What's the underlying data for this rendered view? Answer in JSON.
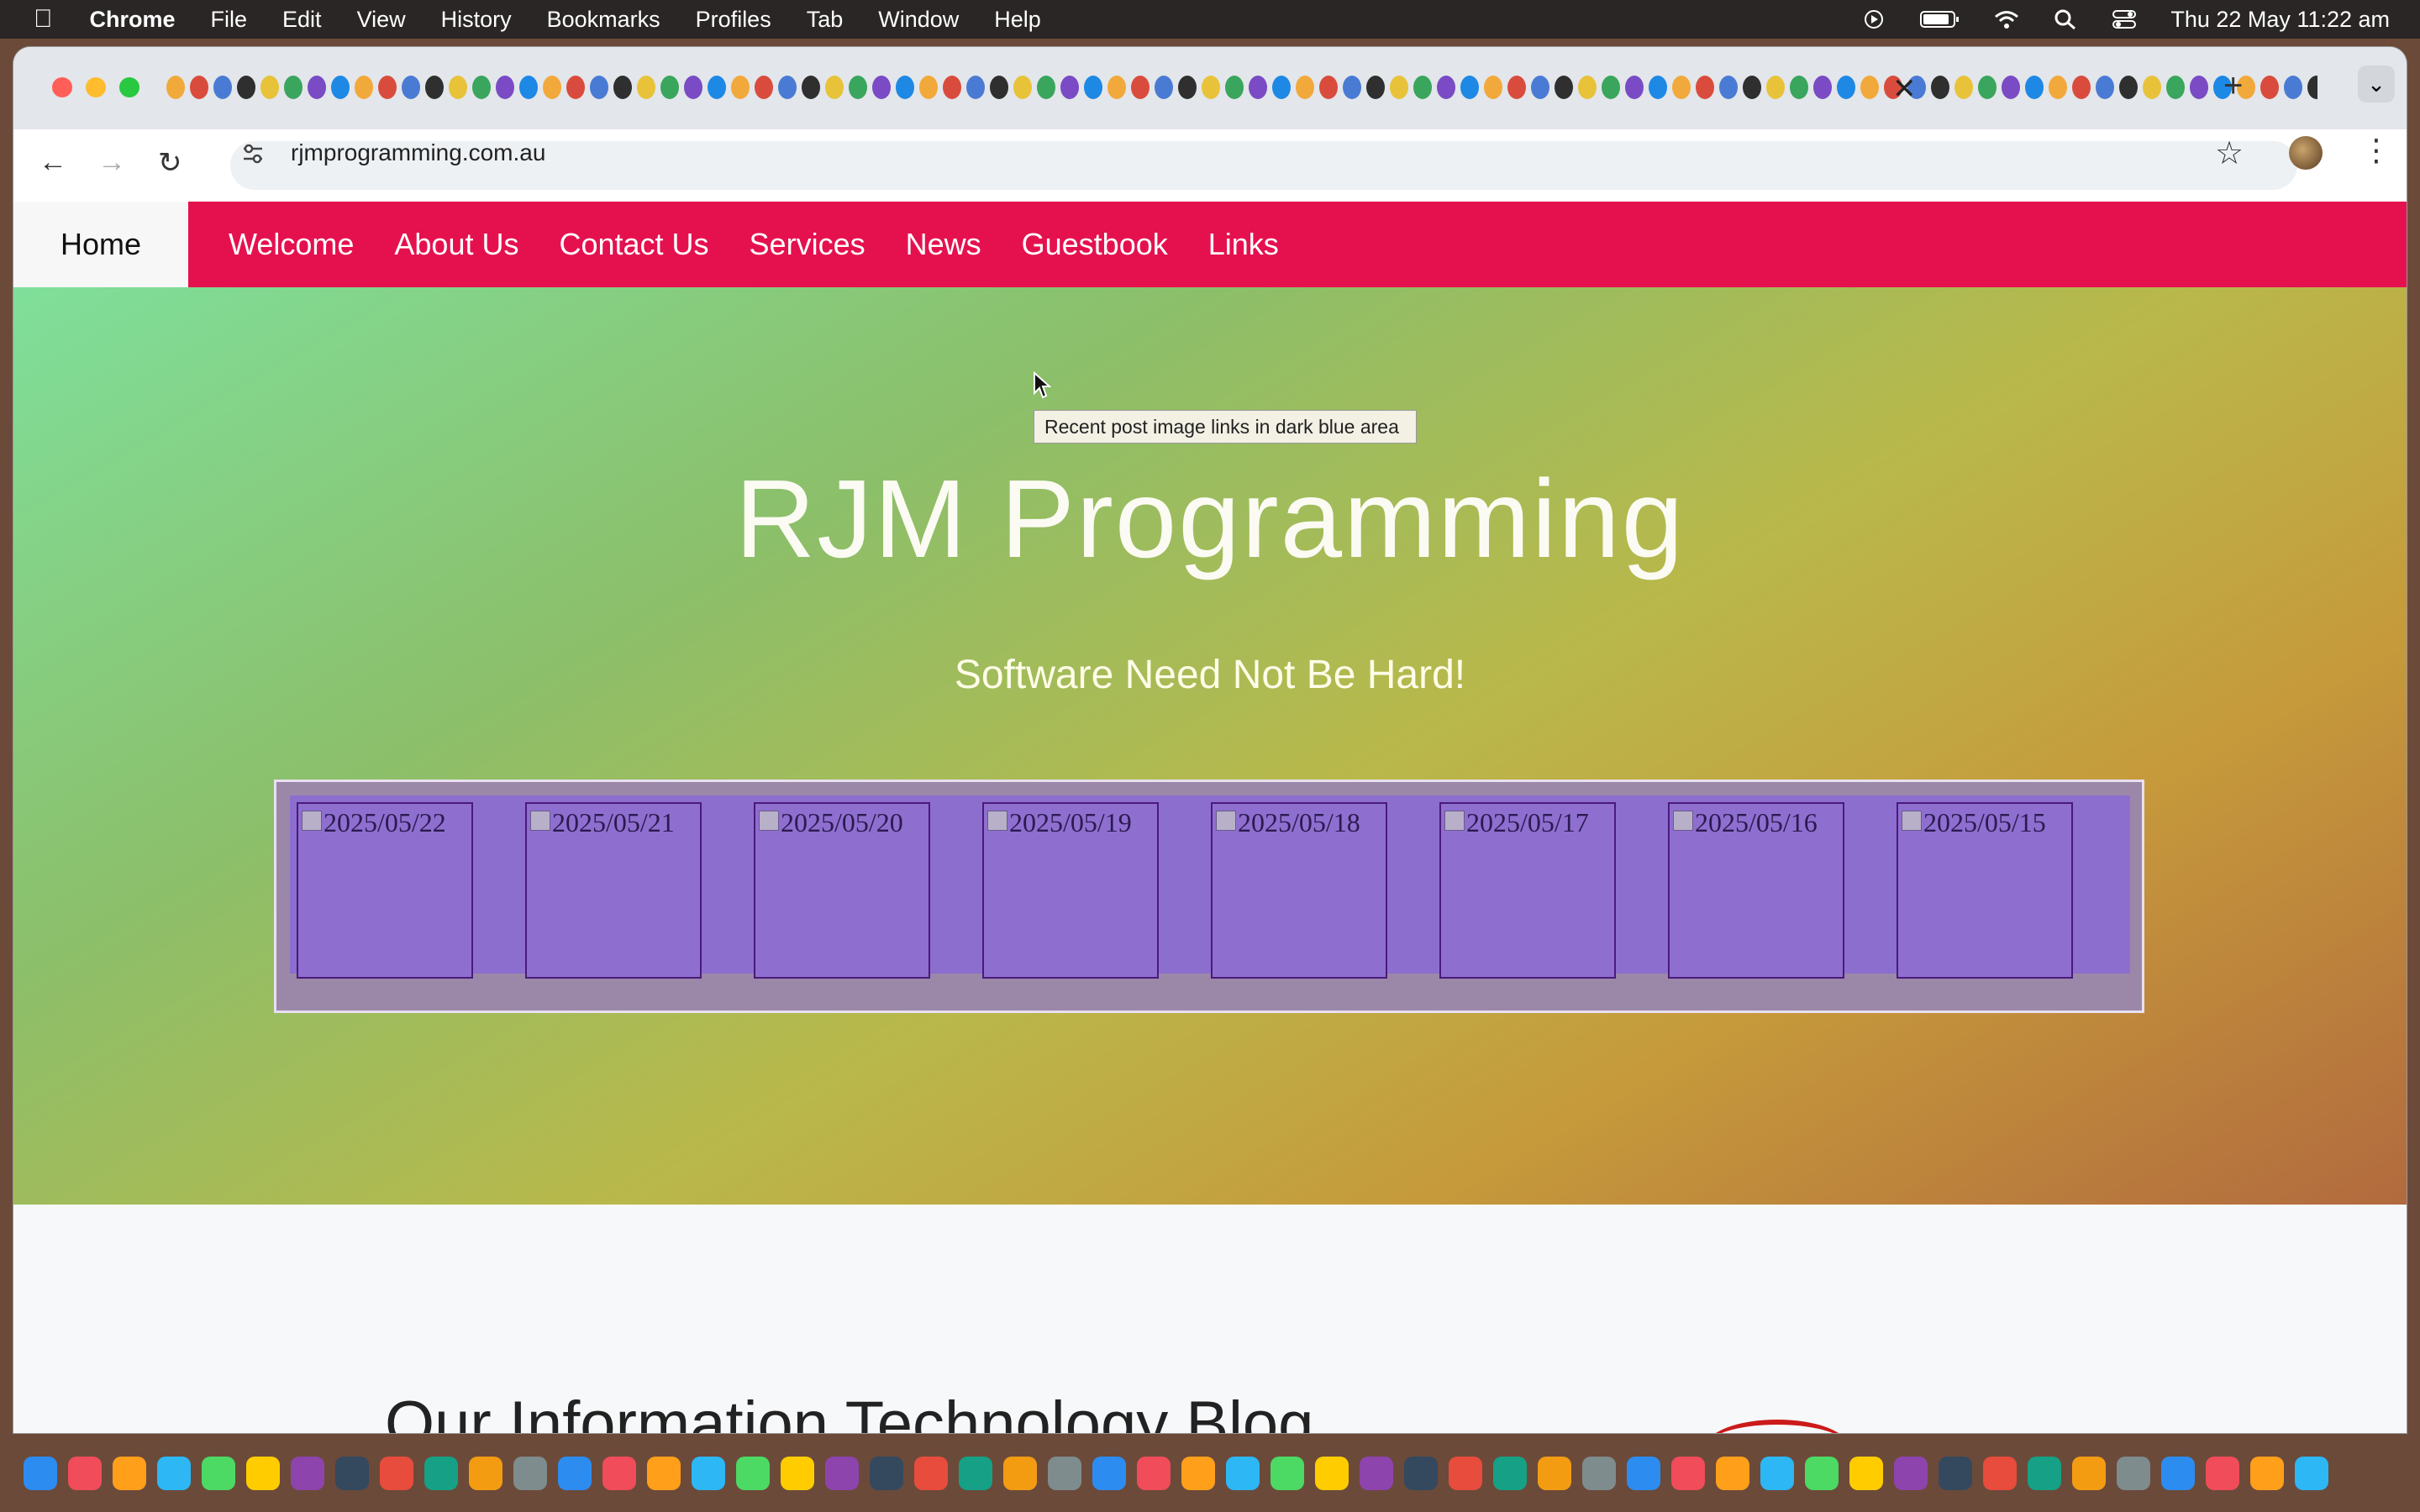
{
  "menubar": {
    "app_name": "Chrome",
    "menus": [
      "File",
      "Edit",
      "View",
      "History",
      "Bookmarks",
      "Profiles",
      "Tab",
      "Window",
      "Help"
    ],
    "clock": "Thu 22 May  11:22 am"
  },
  "browser": {
    "url": "rjmprogramming.com.au",
    "new_tab_symbol": "+",
    "close_symbol": "✕"
  },
  "site": {
    "nav": [
      "Home",
      "Welcome",
      "About Us",
      "Contact Us",
      "Services",
      "News",
      "Guestbook",
      "Links"
    ],
    "tooltip": "Recent post image links in dark blue area",
    "title": "RJM Programming",
    "tagline": "Software Need Not Be Hard!",
    "recent_posts": [
      "2025/05/22",
      "2025/05/21",
      "2025/05/20",
      "2025/05/19",
      "2025/05/18",
      "2025/05/17",
      "2025/05/16",
      "2025/05/15"
    ],
    "blog_heading": "Our Information Technology Blog"
  },
  "colors": {
    "nav_bar": "#e5114f",
    "posts_area": "#8c6ecf"
  }
}
